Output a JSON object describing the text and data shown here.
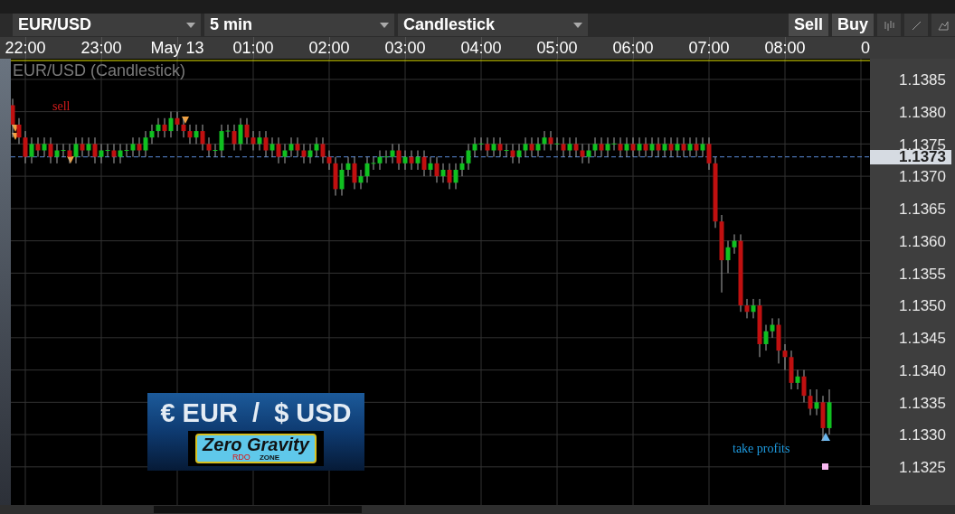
{
  "instrument_select": {
    "value": "EUR/USD"
  },
  "interval_select": {
    "value": "5 min"
  },
  "chart_type_select": {
    "value": "Candlestick"
  },
  "trade_buttons": [
    "Sell",
    "Buy"
  ],
  "chart": {
    "title": "EUR/USD (Candlestick)",
    "annotations": [
      {
        "kind": "sell",
        "text": "sell"
      },
      {
        "kind": "take_profit",
        "text": "take profits"
      }
    ],
    "time_axis_cut_label": "0",
    "chart_data": {
      "type": "candlestick",
      "grid": true,
      "ylim": [
        1.13191,
        1.13882
      ],
      "ref_lines": [
        {
          "axis": "y",
          "value": 1.1373,
          "label": "1.1373",
          "color": "#5a8ad8"
        }
      ],
      "categories": [
        null,
        null,
        "22:00",
        null,
        null,
        null,
        null,
        null,
        null,
        null,
        null,
        null,
        null,
        null,
        "23:00",
        null,
        null,
        null,
        null,
        null,
        null,
        null,
        null,
        null,
        null,
        null,
        "May 13",
        null,
        null,
        null,
        null,
        null,
        null,
        null,
        null,
        null,
        null,
        null,
        "01:00",
        null,
        null,
        null,
        null,
        null,
        null,
        null,
        null,
        null,
        null,
        null,
        "02:00",
        null,
        null,
        null,
        null,
        null,
        null,
        null,
        null,
        null,
        null,
        null,
        "03:00",
        null,
        null,
        null,
        null,
        null,
        null,
        null,
        null,
        null,
        null,
        null,
        "04:00",
        null,
        null,
        null,
        null,
        null,
        null,
        null,
        null,
        null,
        null,
        null,
        "05:00",
        null,
        null,
        null,
        null,
        null,
        null,
        null,
        null,
        null,
        null,
        null,
        "06:00",
        null,
        null,
        null,
        null,
        null,
        null,
        null,
        null,
        null,
        null,
        null,
        "07:00",
        null,
        null,
        null,
        null,
        null,
        null,
        null,
        null,
        null,
        null,
        null,
        "08:00",
        null,
        null,
        null,
        null,
        null,
        null,
        null
      ],
      "yticks": [
        {
          "value": 1.1385,
          "label": "1.1385"
        },
        {
          "value": 1.138,
          "label": "1.1380"
        },
        {
          "value": 1.1375,
          "label": "1.1375"
        },
        {
          "value": 1.137,
          "label": "1.1370"
        },
        {
          "value": 1.1365,
          "label": "1.1365"
        },
        {
          "value": 1.136,
          "label": "1.1360"
        },
        {
          "value": 1.1355,
          "label": "1.1355"
        },
        {
          "value": 1.135,
          "label": "1.1350"
        },
        {
          "value": 1.1345,
          "label": "1.1345"
        },
        {
          "value": 1.134,
          "label": "1.1340"
        },
        {
          "value": 1.1335,
          "label": "1.1335"
        },
        {
          "value": 1.133,
          "label": "1.1330"
        },
        {
          "value": 1.1325,
          "label": "1.1325"
        }
      ],
      "ohlc": [
        [
          1.1381,
          1.1382,
          1.1376,
          1.1378
        ],
        [
          1.1378,
          1.1379,
          1.1375,
          1.1376
        ],
        [
          1.1376,
          1.1377,
          1.1372,
          1.1373
        ],
        [
          1.1373,
          1.1376,
          1.1372,
          1.1375
        ],
        [
          1.1375,
          1.1376,
          1.1373,
          1.1374
        ],
        [
          1.1374,
          1.1376,
          1.1373,
          1.1375
        ],
        [
          1.1375,
          1.1376,
          1.1372,
          1.1373
        ],
        [
          1.1373,
          1.1375,
          1.1372,
          1.1374
        ],
        [
          1.1374,
          1.1375,
          1.1373,
          1.1374
        ],
        [
          1.1374,
          1.1375,
          1.1372,
          1.1373
        ],
        [
          1.1373,
          1.1376,
          1.1372,
          1.1375
        ],
        [
          1.1375,
          1.1376,
          1.1373,
          1.1374
        ],
        [
          1.1374,
          1.1376,
          1.1373,
          1.1375
        ],
        [
          1.1375,
          1.1376,
          1.1372,
          1.1373
        ],
        [
          1.1373,
          1.1375,
          1.1372,
          1.1374
        ],
        [
          1.1374,
          1.1375,
          1.1373,
          1.1374
        ],
        [
          1.1374,
          1.1375,
          1.1372,
          1.1373
        ],
        [
          1.1373,
          1.1375,
          1.1372,
          1.1374
        ],
        [
          1.1374,
          1.1375,
          1.1373,
          1.1374
        ],
        [
          1.1374,
          1.1376,
          1.1373,
          1.1375
        ],
        [
          1.1375,
          1.1376,
          1.1373,
          1.1374
        ],
        [
          1.1374,
          1.1377,
          1.1373,
          1.1376
        ],
        [
          1.1376,
          1.1378,
          1.1375,
          1.1377
        ],
        [
          1.1377,
          1.1379,
          1.1376,
          1.1378
        ],
        [
          1.1378,
          1.1379,
          1.1376,
          1.1377
        ],
        [
          1.1377,
          1.138,
          1.1376,
          1.1379
        ],
        [
          1.1379,
          1.138,
          1.1377,
          1.1378
        ],
        [
          1.1378,
          1.1379,
          1.1376,
          1.1377
        ],
        [
          1.1377,
          1.1378,
          1.1375,
          1.1376
        ],
        [
          1.1376,
          1.1378,
          1.1375,
          1.1377
        ],
        [
          1.1377,
          1.1378,
          1.1374,
          1.1375
        ],
        [
          1.1375,
          1.1376,
          1.1373,
          1.1374
        ],
        [
          1.1374,
          1.1375,
          1.1373,
          1.1374
        ],
        [
          1.1374,
          1.1378,
          1.1373,
          1.1377
        ],
        [
          1.1377,
          1.1378,
          1.1376,
          1.1377
        ],
        [
          1.1377,
          1.1378,
          1.1374,
          1.1375
        ],
        [
          1.1375,
          1.1379,
          1.1374,
          1.1378
        ],
        [
          1.1378,
          1.1379,
          1.1375,
          1.1376
        ],
        [
          1.1376,
          1.1377,
          1.1374,
          1.1375
        ],
        [
          1.1375,
          1.1377,
          1.1374,
          1.1376
        ],
        [
          1.1376,
          1.1377,
          1.1373,
          1.1374
        ],
        [
          1.1374,
          1.1376,
          1.1373,
          1.1375
        ],
        [
          1.1375,
          1.1376,
          1.1372,
          1.1373
        ],
        [
          1.1373,
          1.1375,
          1.1372,
          1.1374
        ],
        [
          1.1374,
          1.1376,
          1.1373,
          1.1375
        ],
        [
          1.1375,
          1.1376,
          1.1373,
          1.1374
        ],
        [
          1.1374,
          1.1375,
          1.1372,
          1.1373
        ],
        [
          1.1373,
          1.1375,
          1.1372,
          1.1374
        ],
        [
          1.1374,
          1.1376,
          1.1373,
          1.1375
        ],
        [
          1.1375,
          1.1376,
          1.1372,
          1.1373
        ],
        [
          1.1373,
          1.1374,
          1.1371,
          1.1372
        ],
        [
          1.1372,
          1.1373,
          1.1367,
          1.1368
        ],
        [
          1.1368,
          1.1372,
          1.1367,
          1.1371
        ],
        [
          1.1371,
          1.1373,
          1.137,
          1.1372
        ],
        [
          1.1372,
          1.1373,
          1.1368,
          1.1369
        ],
        [
          1.1369,
          1.1371,
          1.1368,
          1.137
        ],
        [
          1.137,
          1.1373,
          1.1369,
          1.1372
        ],
        [
          1.1372,
          1.1373,
          1.1371,
          1.1372
        ],
        [
          1.1372,
          1.1374,
          1.1371,
          1.1373
        ],
        [
          1.1373,
          1.1374,
          1.1372,
          1.1373
        ],
        [
          1.1373,
          1.1375,
          1.1372,
          1.1374
        ],
        [
          1.1374,
          1.1375,
          1.1371,
          1.1372
        ],
        [
          1.1372,
          1.1374,
          1.1371,
          1.1373
        ],
        [
          1.1373,
          1.1374,
          1.1371,
          1.1372
        ],
        [
          1.1372,
          1.1374,
          1.1371,
          1.1373
        ],
        [
          1.1373,
          1.1374,
          1.137,
          1.1371
        ],
        [
          1.1371,
          1.1373,
          1.137,
          1.1372
        ],
        [
          1.1372,
          1.1373,
          1.1369,
          1.137
        ],
        [
          1.137,
          1.1372,
          1.1369,
          1.1371
        ],
        [
          1.1371,
          1.1372,
          1.1368,
          1.1369
        ],
        [
          1.1369,
          1.1372,
          1.1368,
          1.1371
        ],
        [
          1.1371,
          1.1373,
          1.137,
          1.1372
        ],
        [
          1.1372,
          1.1375,
          1.1371,
          1.1374
        ],
        [
          1.1374,
          1.1376,
          1.1373,
          1.1375
        ],
        [
          1.1375,
          1.1376,
          1.1374,
          1.1375
        ],
        [
          1.1375,
          1.1376,
          1.1373,
          1.1374
        ],
        [
          1.1374,
          1.1376,
          1.1373,
          1.1375
        ],
        [
          1.1375,
          1.1376,
          1.1373,
          1.1374
        ],
        [
          1.1374,
          1.1375,
          1.1373,
          1.1374
        ],
        [
          1.1374,
          1.1375,
          1.1372,
          1.1373
        ],
        [
          1.1373,
          1.1375,
          1.1372,
          1.1374
        ],
        [
          1.1374,
          1.1376,
          1.1373,
          1.1375
        ],
        [
          1.1375,
          1.1376,
          1.1373,
          1.1374
        ],
        [
          1.1374,
          1.1376,
          1.1373,
          1.1375
        ],
        [
          1.1375,
          1.1377,
          1.1374,
          1.1376
        ],
        [
          1.1376,
          1.1377,
          1.1374,
          1.1375
        ],
        [
          1.1375,
          1.1376,
          1.1374,
          1.1375
        ],
        [
          1.1375,
          1.1376,
          1.1373,
          1.1374
        ],
        [
          1.1374,
          1.1376,
          1.1373,
          1.1375
        ],
        [
          1.1375,
          1.1376,
          1.1373,
          1.1374
        ],
        [
          1.1374,
          1.1375,
          1.1372,
          1.1373
        ],
        [
          1.1373,
          1.1375,
          1.1372,
          1.1374
        ],
        [
          1.1374,
          1.1376,
          1.1373,
          1.1375
        ],
        [
          1.1375,
          1.1376,
          1.1373,
          1.1374
        ],
        [
          1.1374,
          1.1376,
          1.1373,
          1.1375
        ],
        [
          1.1375,
          1.1376,
          1.1374,
          1.1375
        ],
        [
          1.1375,
          1.1376,
          1.1373,
          1.1374
        ],
        [
          1.1374,
          1.1376,
          1.1373,
          1.1375
        ],
        [
          1.1375,
          1.1376,
          1.1373,
          1.1374
        ],
        [
          1.1374,
          1.1376,
          1.1373,
          1.1375
        ],
        [
          1.1375,
          1.1376,
          1.1373,
          1.1374
        ],
        [
          1.1374,
          1.1376,
          1.1373,
          1.1375
        ],
        [
          1.1375,
          1.1376,
          1.1373,
          1.1374
        ],
        [
          1.1374,
          1.1376,
          1.1373,
          1.1375
        ],
        [
          1.1375,
          1.1376,
          1.1373,
          1.1374
        ],
        [
          1.1374,
          1.1376,
          1.1373,
          1.1375
        ],
        [
          1.1375,
          1.1376,
          1.1373,
          1.1374
        ],
        [
          1.1374,
          1.1376,
          1.1373,
          1.1375
        ],
        [
          1.1375,
          1.1376,
          1.1373,
          1.1374
        ],
        [
          1.1374,
          1.1376,
          1.1373,
          1.1375
        ],
        [
          1.1375,
          1.1376,
          1.1371,
          1.1372
        ],
        [
          1.1372,
          1.1373,
          1.1362,
          1.1363
        ],
        [
          1.1363,
          1.1364,
          1.1352,
          1.1357
        ],
        [
          1.1357,
          1.136,
          1.1355,
          1.1359
        ],
        [
          1.1359,
          1.1361,
          1.1358,
          1.136
        ],
        [
          1.136,
          1.1361,
          1.1349,
          1.135
        ],
        [
          1.135,
          1.1351,
          1.1348,
          1.1349
        ],
        [
          1.1349,
          1.1351,
          1.1348,
          1.135
        ],
        [
          1.135,
          1.1351,
          1.1342,
          1.1344
        ],
        [
          1.1344,
          1.1347,
          1.1343,
          1.1346
        ],
        [
          1.1346,
          1.1348,
          1.1345,
          1.1347
        ],
        [
          1.1347,
          1.1348,
          1.1341,
          1.1343
        ],
        [
          1.1343,
          1.1344,
          1.134,
          1.1342
        ],
        [
          1.1342,
          1.1343,
          1.1337,
          1.1338
        ],
        [
          1.1338,
          1.134,
          1.1337,
          1.1339
        ],
        [
          1.1339,
          1.134,
          1.1335,
          1.1336
        ],
        [
          1.1336,
          1.1337,
          1.1333,
          1.1334
        ],
        [
          1.1334,
          1.1337,
          1.1333,
          1.1335
        ],
        [
          1.1335,
          1.1336,
          1.1329,
          1.1331
        ],
        [
          1.1331,
          1.1337,
          1.133,
          1.1335
        ]
      ]
    }
  },
  "logo": {
    "headline": "€ EUR  /  $ USD",
    "badge": "Zero Gravity",
    "badge_sub": "ZONE",
    "badge_tag": "RDO"
  }
}
